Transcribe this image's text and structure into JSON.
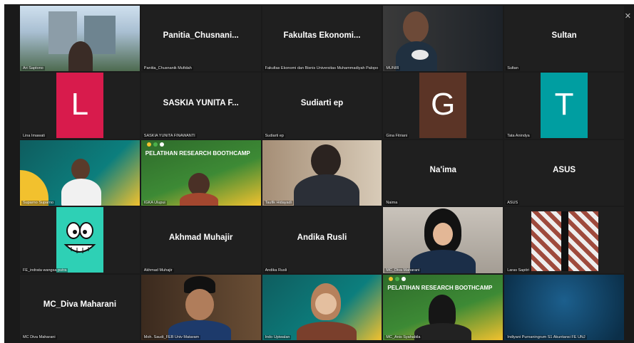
{
  "window": {
    "minimize_icon": "–",
    "restore_icon": "❐",
    "close_icon": "✕"
  },
  "tiles": [
    {
      "display": "",
      "label": "Ari Saptono",
      "kind": "video"
    },
    {
      "display": "Panitia_Chusnani...",
      "label": "Panitia_Chusnanik Mufidah",
      "kind": "name"
    },
    {
      "display": "Fakultas Ekonomi...",
      "label": "Fakultas Ekonomi dan Bisnis Universitas Muhammadiyah Palopo",
      "kind": "name"
    },
    {
      "display": "",
      "label": "MUNIR",
      "kind": "video"
    },
    {
      "display": "Sultan",
      "label": "Sultan",
      "kind": "name"
    },
    {
      "display": "L",
      "label": "Lina Imawati",
      "kind": "avatar",
      "color": "#d81b4c"
    },
    {
      "display": "SASKIA YUNITA F...",
      "label": "SASKIA YUNITA FINAWANTI",
      "kind": "name"
    },
    {
      "display": "Sudiarti ep",
      "label": "Sudiarti ep",
      "kind": "name"
    },
    {
      "display": "G",
      "label": "Gina Fitriani",
      "kind": "avatar",
      "color": "#5b3426"
    },
    {
      "display": "T",
      "label": "Tata Anindya",
      "kind": "avatar",
      "color": "#009ea1"
    },
    {
      "display": "",
      "label": "Suparno Suparno",
      "kind": "video"
    },
    {
      "display": "",
      "label": "IGKA Ulupui",
      "kind": "video",
      "banner": "PELATIHAN RESEARCH BOOTHCAMP"
    },
    {
      "display": "",
      "label": "Taufik Hidayadi",
      "kind": "video"
    },
    {
      "display": "Na'ima",
      "label": "Naima",
      "kind": "name"
    },
    {
      "display": "ASUS",
      "label": "ASUS",
      "kind": "name"
    },
    {
      "display": "",
      "label": "FE_indrata wangsa putra",
      "kind": "avatar-img"
    },
    {
      "display": "Akhmad Muhajir",
      "label": "Akhmad Muhajir",
      "kind": "name"
    },
    {
      "display": "Andika Rusli",
      "label": "Andika Rusli",
      "kind": "name"
    },
    {
      "display": "",
      "label": "MC_Diva Maharani",
      "kind": "video"
    },
    {
      "display": "",
      "label": "Laras Sapitri",
      "kind": "video"
    },
    {
      "display": "MC_Diva Maharani",
      "label": "MC Diva Maharani",
      "kind": "name"
    },
    {
      "display": "",
      "label": "Moh. Saudi_FEB Univ Mataram",
      "kind": "video"
    },
    {
      "display": "",
      "label": "Indo Upiwalan",
      "kind": "video"
    },
    {
      "display": "",
      "label": "MC_Anis Syahabila",
      "kind": "video",
      "banner": "PELATIHAN RESEARCH BOOTHCAMP"
    },
    {
      "display": "",
      "label": "Indiyani Purnaningrum S1 Akuntansi FE UNJ",
      "kind": "video"
    }
  ]
}
